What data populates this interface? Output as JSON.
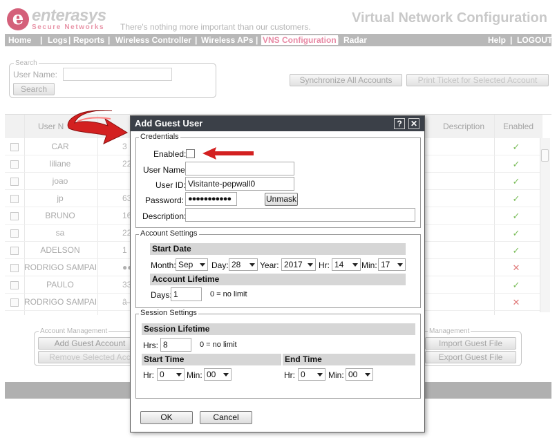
{
  "header": {
    "logo_letter": "e",
    "brand": "enterasys",
    "brand_sub": "Secure Networks",
    "tagline": "There's nothing more important than our customers.",
    "title": "Virtual Network Configuration"
  },
  "nav": {
    "items": [
      "Home",
      "Logs",
      "Reports",
      "Wireless Controller",
      "Wireless APs",
      "VNS Configuration",
      "Radar"
    ],
    "right": [
      "Help",
      "LOGOUT"
    ],
    "separator": "|"
  },
  "search": {
    "legend": "Search",
    "user_name_label": "User Name:",
    "user_name_value": "",
    "button": "Search"
  },
  "actions": {
    "sync": "Synchronize All Accounts",
    "print": "Print Ticket for Selected Account"
  },
  "table": {
    "headers": {
      "user": "User N",
      "description": "Description",
      "enabled": "Enabled"
    },
    "rows": [
      {
        "name": "CAR",
        "pw": "3",
        "enabled": "✓"
      },
      {
        "name": "liliane",
        "pw": "22",
        "enabled": "✓"
      },
      {
        "name": "joao",
        "pw": "",
        "enabled": "✓"
      },
      {
        "name": "jp",
        "pw": "63",
        "enabled": "✓"
      },
      {
        "name": "BRUNO",
        "pw": "16",
        "enabled": "✓"
      },
      {
        "name": "sa",
        "pw": "22",
        "enabled": "✓"
      },
      {
        "name": "ADELSON",
        "pw": "1",
        "enabled": "✓"
      },
      {
        "name": "RODRIGO SAMPAIO",
        "pw": "●●",
        "enabled": "✕"
      },
      {
        "name": "PAULO",
        "pw": "33",
        "enabled": "✓"
      },
      {
        "name": "RODRIGO SAMPAIO",
        "pw": "â—â—",
        "enabled": "✕"
      }
    ],
    "colors": {
      "check": "#7bbd5a",
      "cross": "#e07a7a"
    }
  },
  "account_management": {
    "legend": "Account Management",
    "add": "Add Guest Account",
    "remove": "Remove Selected Acc",
    "right_legend": "Management",
    "import": "Import Guest File",
    "export": "Export Guest File"
  },
  "dialog": {
    "title": "Add Guest User",
    "help": "?",
    "close": "✕",
    "credentials": {
      "legend": "Credentials",
      "enabled_label": "Enabled:",
      "user_name_label": "User Name:",
      "user_name_value": "",
      "user_id_label": "User ID:",
      "user_id_value": "Visitante-pepwall0",
      "password_label": "Password:",
      "password_value": "●●●●●●●●●●●",
      "unmask": "Unmask",
      "description_label": "Description:",
      "description_value": ""
    },
    "account_settings": {
      "legend": "Account Settings",
      "start_date": "Start Date",
      "month_label": "Month:",
      "month": "Sep",
      "day_label": "Day:",
      "day": "28",
      "year_label": "Year:",
      "year": "2017",
      "hr_label": "Hr:",
      "hr": "14",
      "min_label": "Min:",
      "min": "17",
      "lifetime": "Account Lifetime",
      "days_label": "Days:",
      "days": "1",
      "no_limit": "0 = no limit"
    },
    "session_settings": {
      "legend": "Session Settings",
      "lifetime": "Session Lifetime",
      "hrs_label": "Hrs:",
      "hrs": "8",
      "no_limit": "0 = no limit",
      "start_time": "Start Time",
      "end_time": "End Time",
      "start_hr_label": "Hr:",
      "start_hr": "0",
      "start_min_label": "Min:",
      "start_min": "00",
      "end_hr_label": "Hr:",
      "end_hr": "0",
      "end_min_label": "Min:",
      "end_min": "00"
    },
    "ok": "OK",
    "cancel": "Cancel"
  },
  "annotation_color": "#cc1f1f"
}
